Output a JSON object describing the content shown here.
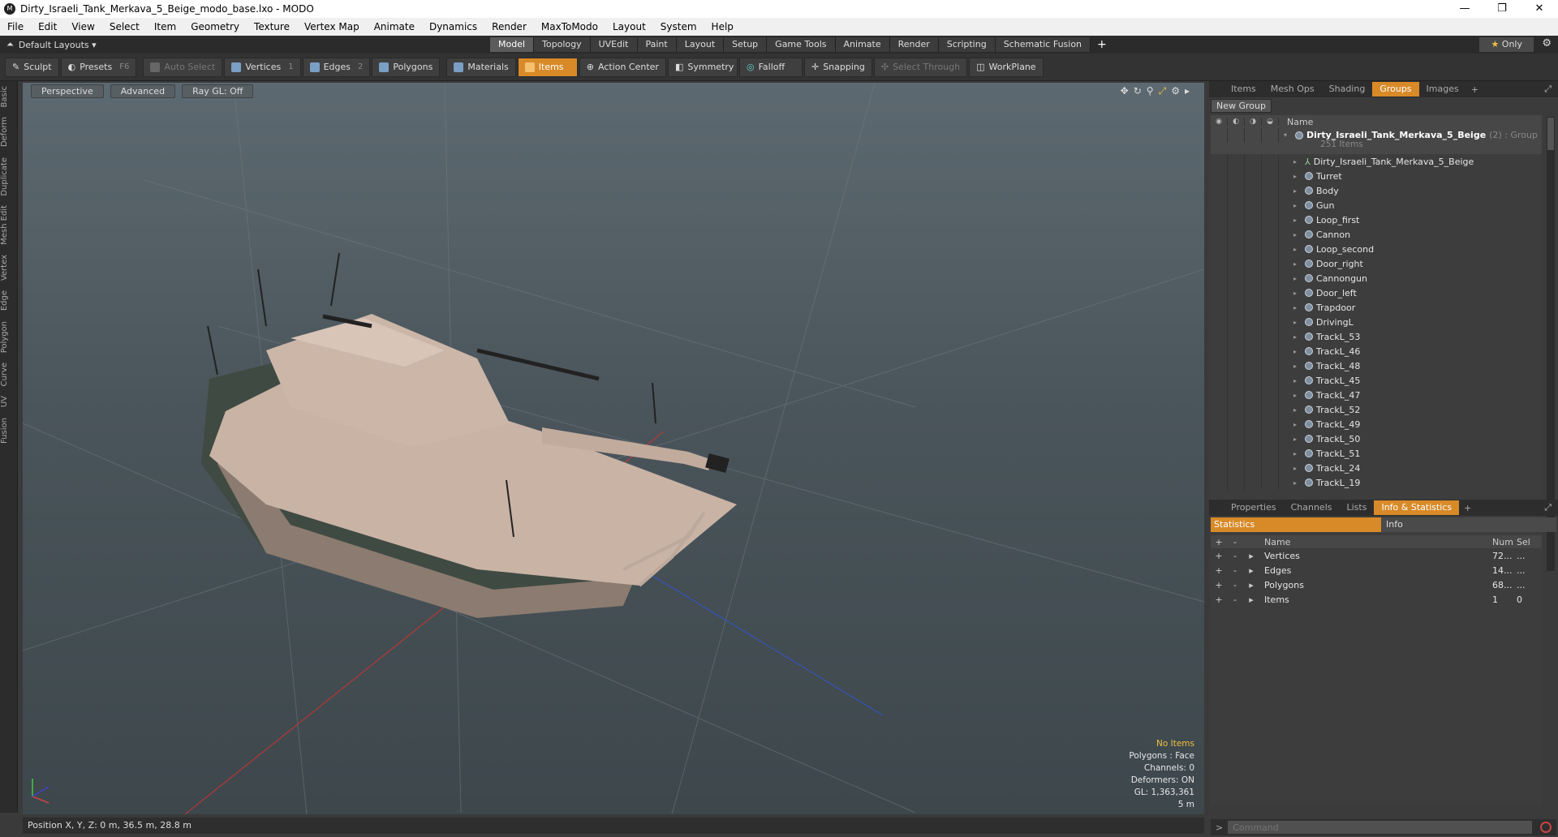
{
  "window": {
    "title": "Dirty_Israeli_Tank_Merkava_5_Beige_modo_base.lxo - MODO",
    "controls": [
      "—",
      "❐",
      "✕"
    ]
  },
  "menu": [
    "File",
    "Edit",
    "View",
    "Select",
    "Item",
    "Geometry",
    "Texture",
    "Vertex Map",
    "Animate",
    "Dynamics",
    "Render",
    "MaxToModo",
    "Layout",
    "System",
    "Help"
  ],
  "layout": {
    "selector": "Default Layouts",
    "tabs": [
      "Model",
      "Topology",
      "UVEdit",
      "Paint",
      "Layout",
      "Setup",
      "Game Tools",
      "Animate",
      "Render",
      "Scripting",
      "Schematic Fusion"
    ],
    "active_tab": "Model",
    "only": "Only"
  },
  "toolbar": {
    "sculpt": "Sculpt",
    "presets": "Presets",
    "presets_key": "F6",
    "auto_select": "Auto Select",
    "vertices": "Vertices",
    "vertices_count": "1",
    "edges": "Edges",
    "edges_count": "2",
    "polygons": "Polygons",
    "materials": "Materials",
    "items": "Items",
    "action_center": "Action Center",
    "symmetry": "Symmetry",
    "falloff": "Falloff",
    "snapping": "Snapping",
    "select_through": "Select Through",
    "workplane": "WorkPlane"
  },
  "left_tabs": [
    "Basic",
    "Deform",
    "Duplicate",
    "Mesh Edit",
    "Vertex",
    "Edge",
    "Polygon",
    "Curve",
    "UV",
    "Fusion"
  ],
  "viewport": {
    "perspective": "Perspective",
    "advanced": "Advanced",
    "raygl": "Ray GL: Off",
    "info": {
      "no_items": "No Items",
      "polygons": "Polygons : Face",
      "channels": "Channels: 0",
      "deformers": "Deformers: ON",
      "gl": "GL: 1,363,361",
      "scale": "5 m"
    }
  },
  "status": "Position X, Y, Z:   0 m, 36.5 m, 28.8 m",
  "top_panel": {
    "tabs": [
      "Items",
      "Mesh Ops",
      "Shading",
      "Groups",
      "Images"
    ],
    "active": "Groups",
    "new_group": "New Group",
    "name_header": "Name",
    "root": {
      "name": "Dirty_Israeli_Tank_Merkava_5_Beige",
      "suffix": "(2) : Group",
      "count": "251 Items"
    },
    "items": [
      "Dirty_Israeli_Tank_Merkava_5_Beige",
      "Turret",
      "Body",
      "Gun",
      "Loop_first",
      "Cannon",
      "Loop_second",
      "Door_right",
      "Cannongun",
      "Door_left",
      "Trapdoor",
      "DrivingL",
      "TrackL_53",
      "TrackL_46",
      "TrackL_48",
      "TrackL_45",
      "TrackL_47",
      "TrackL_52",
      "TrackL_49",
      "TrackL_50",
      "TrackL_51",
      "TrackL_24",
      "TrackL_19"
    ]
  },
  "bottom_panel": {
    "tabs": [
      "Properties",
      "Channels",
      "Lists",
      "Info & Statistics"
    ],
    "active": "Info & Statistics",
    "statistics": "Statistics",
    "info": "Info",
    "headers": {
      "name": "Name",
      "num": "Num",
      "sel": "Sel"
    },
    "rows": [
      {
        "name": "Vertices",
        "num": "72...",
        "sel": "..."
      },
      {
        "name": "Edges",
        "num": "14...",
        "sel": "..."
      },
      {
        "name": "Polygons",
        "num": "68...",
        "sel": "..."
      },
      {
        "name": "Items",
        "num": "1",
        "sel": "0"
      }
    ],
    "command_placeholder": "Command"
  },
  "colors": {
    "accent": "#d88a28",
    "tank": "#c4ae9f",
    "grid": "#6f7a80"
  }
}
